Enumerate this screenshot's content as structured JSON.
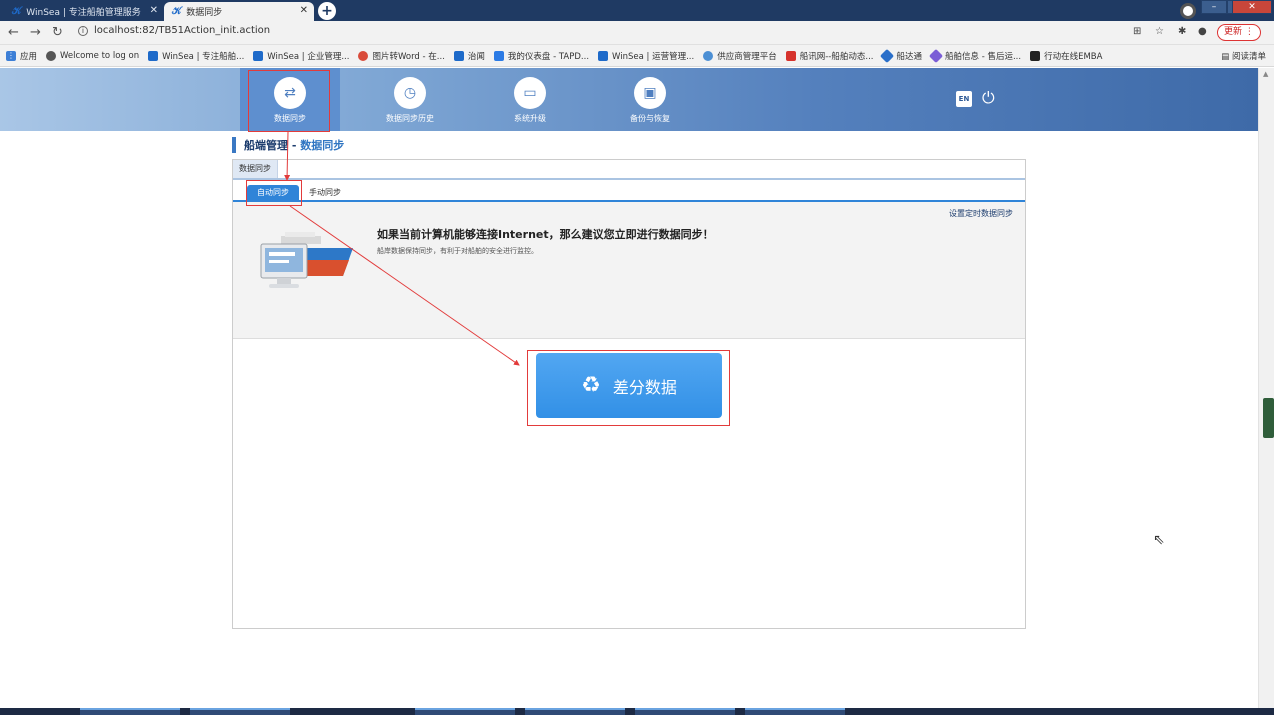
{
  "browser": {
    "tabs": [
      {
        "label": "WinSea | 专注船舶管理服务",
        "active": false
      },
      {
        "label": "数据同步",
        "active": true
      }
    ],
    "url": "localhost:82/TB51Action_init.action",
    "update_label": "更新",
    "bookmarks": [
      {
        "label": "应用",
        "icon": "apps-icon"
      },
      {
        "label": "Welcome to log on",
        "icon": "globe-icon"
      },
      {
        "label": "WinSea | 专注船舶...",
        "icon": "winsea-icon"
      },
      {
        "label": "WinSea | 企业管理...",
        "icon": "winsea-icon"
      },
      {
        "label": "图片转Word - 在...",
        "icon": "image-icon"
      },
      {
        "label": "治闻",
        "icon": "winsea-icon"
      },
      {
        "label": "我的仪表盘 - TAPD...",
        "icon": "dashboard-icon"
      },
      {
        "label": "WinSea | 运营管理...",
        "icon": "winsea-icon"
      },
      {
        "label": "供应商管理平台",
        "icon": "gear-icon"
      },
      {
        "label": "船讯网--船舶动态...",
        "icon": "ship-icon"
      },
      {
        "label": "船达通",
        "icon": "diamond-icon"
      },
      {
        "label": "船舶信息 - 售后运...",
        "icon": "diamond-icon"
      },
      {
        "label": "行动在线EMBA",
        "icon": "emba-icon"
      }
    ],
    "reading_list": "阅读清单"
  },
  "app": {
    "nav": [
      {
        "label": "数据同步",
        "icon": "sync-icon",
        "active": true
      },
      {
        "label": "数据同步历史",
        "icon": "history-icon",
        "active": false
      },
      {
        "label": "系统升级",
        "icon": "monitor-icon",
        "active": false
      },
      {
        "label": "备份与恢复",
        "icon": "disk-icon",
        "active": false
      }
    ],
    "lang_label": "EN",
    "breadcrumb": {
      "main": "船端管理",
      "sep": " - ",
      "sub": "数据同步"
    },
    "panel_tab": "数据同步",
    "subtabs": [
      {
        "label": "自动同步",
        "active": true
      },
      {
        "label": "手动同步",
        "active": false
      }
    ],
    "schedule_link": "设置定时数据同步",
    "headline": "如果当前计算机能够连接Internet，那么建议您立即进行数据同步！",
    "subline": "船岸数据保持同步，有利于对船舶的安全进行监控。",
    "diff_button": "差分数据"
  },
  "colors": {
    "accent": "#2f84d8",
    "header_dark": "#3e6aa8",
    "annotation": "#e23b3b"
  }
}
